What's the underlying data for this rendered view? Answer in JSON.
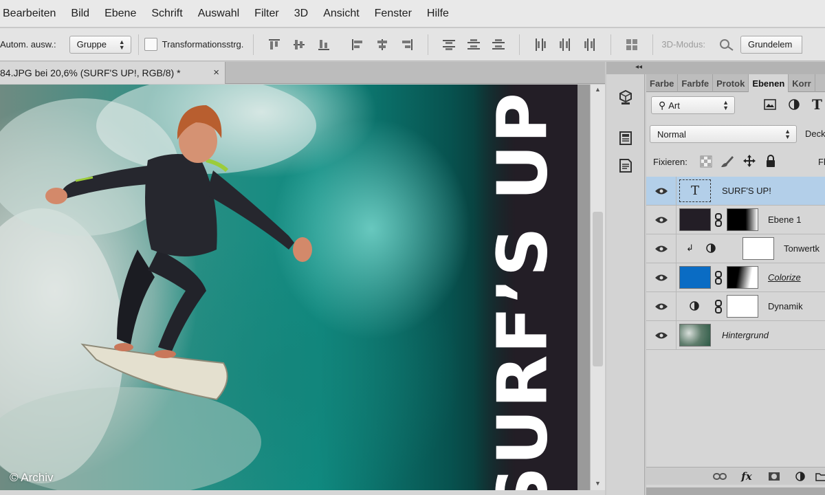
{
  "menu": {
    "items": [
      {
        "label": "Bearbeiten"
      },
      {
        "label": "Bild"
      },
      {
        "label": "Ebene"
      },
      {
        "label": "Schrift"
      },
      {
        "label": "Auswahl"
      },
      {
        "label": "Filter"
      },
      {
        "label": "3D"
      },
      {
        "label": "Ansicht"
      },
      {
        "label": "Fenster"
      },
      {
        "label": "Hilfe"
      }
    ]
  },
  "options_bar": {
    "auto_select_label": "Autom. ausw.:",
    "auto_select_value": "Gruppe",
    "transform_controls_label": "Transformationsstrg.",
    "transform_controls_checked": false,
    "mode_3d_label": "3D-Modus:",
    "workspace_value": "Grundelem"
  },
  "document": {
    "tab_title": "84.JPG bei 20,6% (SURF'S UP!, RGB/8) *",
    "close_symbol": "×",
    "headline": "SURF’S UP!",
    "watermark": "© Archiv"
  },
  "panel": {
    "tabs": [
      {
        "label": "Farbe",
        "active": false
      },
      {
        "label": "Farbfe",
        "active": false
      },
      {
        "label": "Protok",
        "active": false
      },
      {
        "label": "Ebenen",
        "active": true
      },
      {
        "label": "Korr",
        "active": false
      }
    ],
    "filter_kind": "Art",
    "blend_mode": "Normal",
    "opacity_label": "Deck",
    "lock_label": "Fixieren:",
    "fill_label": "Fl",
    "layers": [
      {
        "name": "SURF'S UP!",
        "type": "text",
        "selected": true,
        "italic": false,
        "underlined": false
      },
      {
        "name": "Ebene 1",
        "type": "masked",
        "selected": false,
        "italic": false,
        "underlined": false,
        "color": "#231e26"
      },
      {
        "name": "Tonwertk",
        "type": "adjustment-clipped",
        "selected": false,
        "italic": false,
        "underlined": false
      },
      {
        "name": "Colorize",
        "type": "color-fill",
        "selected": false,
        "italic": true,
        "underlined": true,
        "color": "#0a6cc4"
      },
      {
        "name": "Dynamik",
        "type": "adjustment",
        "selected": false,
        "italic": false,
        "underlined": false
      },
      {
        "name": "Hintergrund",
        "type": "background",
        "selected": false,
        "italic": true,
        "underlined": false
      }
    ]
  }
}
